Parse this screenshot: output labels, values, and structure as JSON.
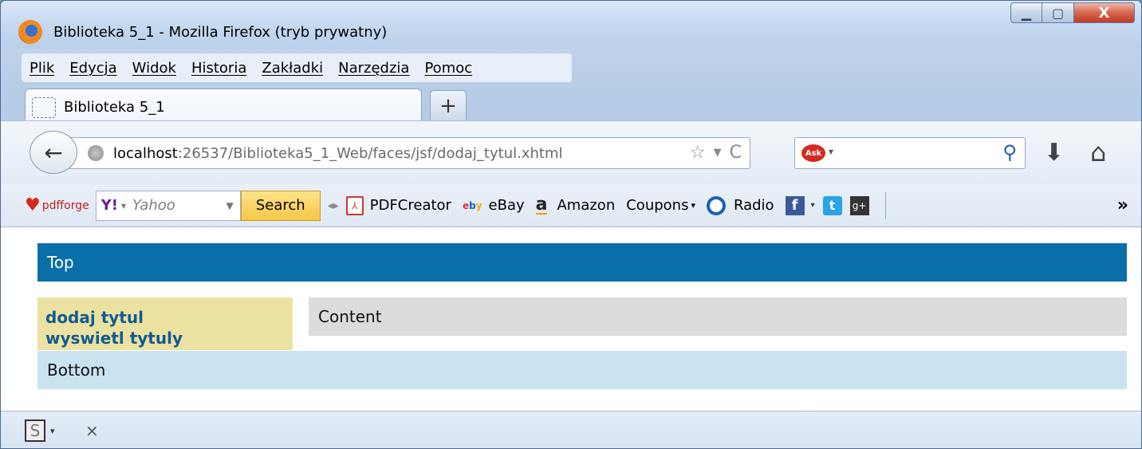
{
  "window": {
    "title": "Biblioteka 5_1 - Mozilla Firefox (tryb prywatny)",
    "minimize": "▁",
    "maximize": "▢",
    "close": "X"
  },
  "menu": [
    "Plik",
    "Edycja",
    "Widok",
    "Historia",
    "Zakładki",
    "Narzędzia",
    "Pomoc"
  ],
  "tab": {
    "label": "Biblioteka 5_1",
    "new_tab": "+"
  },
  "urlbar": {
    "host": "localhost",
    "rest": ":26537/Biblioteka5_1_Web/faces/jsf/dodaj_tytul.xhtml",
    "star": "☆",
    "drop": "▼",
    "reload": "C"
  },
  "search": {
    "engine_label": "Ask",
    "drop": "▾",
    "icon": "⚲"
  },
  "toolbar": {
    "back": "←",
    "download": "⬇",
    "home": "⌂"
  },
  "bookmarks": {
    "pdfforge": "pdfforge",
    "yahoo_logo": "Y!",
    "yahoo_drop": "▾",
    "yahoo_text": "Yahoo",
    "yahoo_box_drop": "▼",
    "search_button": "Search",
    "grip": "◂▸",
    "pdfcreator": "PDFCreator",
    "pdf_icon": "⅄",
    "ebay": "eBay",
    "ebay_logo": [
      "e",
      "b",
      "y"
    ],
    "amazon": "Amazon",
    "amazon_logo": "a",
    "coupons": "Coupons",
    "coupons_drop": "▾",
    "radio": "Radio",
    "fb_icon": "f",
    "fb_drop": "▾",
    "tw_icon": "t",
    "gp_icon": "g+",
    "more": "»"
  },
  "page": {
    "top": "Top",
    "links": [
      "dodaj tytul",
      "wyswietl tytuly"
    ],
    "content": "Content",
    "bottom": "Bottom"
  },
  "addonbar": {
    "s_icon": "S",
    "drop": "▾",
    "close": "×"
  }
}
